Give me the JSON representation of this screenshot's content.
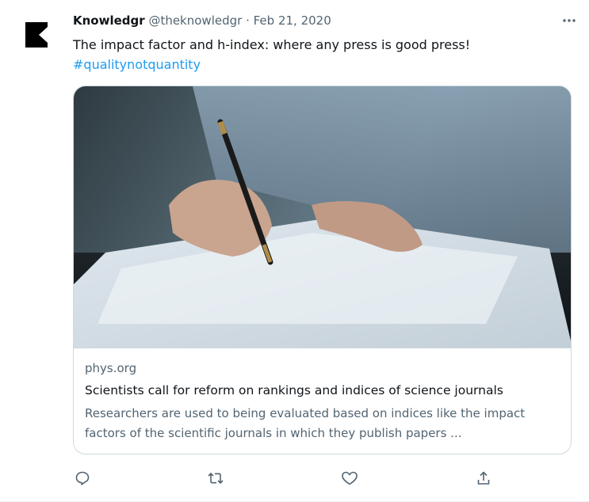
{
  "tweet": {
    "display_name": "Knowledgr",
    "handle": "@theknowledgr",
    "separator": " · ",
    "date": "Feb 21, 2020",
    "text": "The impact factor and h-index: where any press is good press!",
    "hashtag": "#qualitynotquantity"
  },
  "card": {
    "image": "photo-hand-writing-with-pen-on-paper",
    "domain": "phys.org",
    "title": "Scientists call for reform on rankings and indices of science journals",
    "description": "Researchers are used to being evaluated based on indices like the impact factors of the scientific journals in which they publish papers ..."
  },
  "actions": {
    "reply_icon": "reply-icon",
    "retweet_icon": "retweet-icon",
    "like_icon": "heart-icon",
    "share_icon": "share-icon"
  },
  "colors": {
    "link": "#1d9bf0",
    "secondary_text": "#536471",
    "primary_text": "#0f1419",
    "border": "#cfd9de"
  }
}
